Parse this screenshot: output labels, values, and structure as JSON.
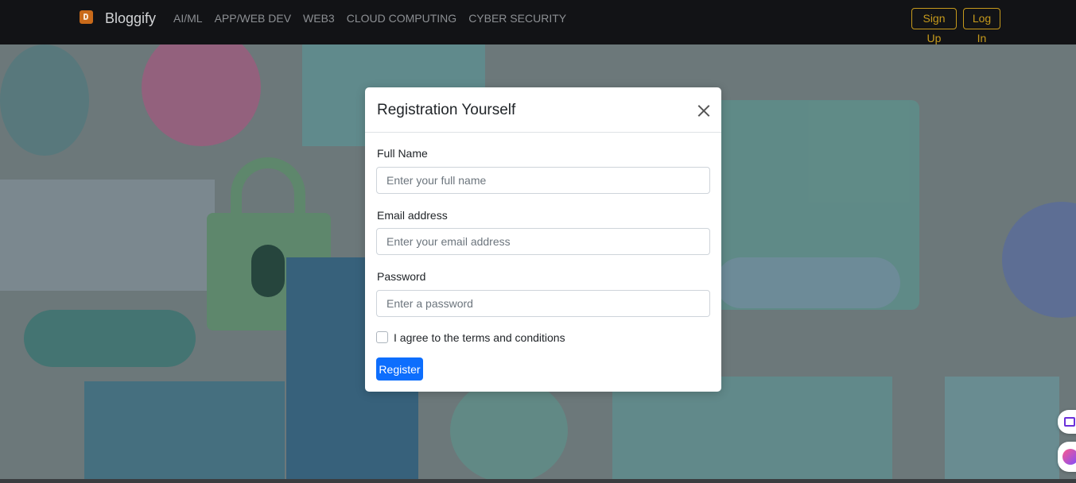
{
  "navbar": {
    "brand": "Bloggify",
    "links": [
      "AI/ML",
      "APP/WEB DEV",
      "WEB3",
      "CLOUD COMPUTING",
      "CYBER SECURITY"
    ],
    "signup_label": "Sign Up",
    "login_label": "Log In"
  },
  "modal": {
    "title": "Registration Yourself",
    "fields": [
      {
        "label": "Full Name",
        "placeholder": "Enter your full name",
        "value": ""
      },
      {
        "label": "Email address",
        "placeholder": "Enter your email address",
        "value": ""
      },
      {
        "label": "Password",
        "placeholder": "Enter a password",
        "value": ""
      }
    ],
    "agree_label": "I agree to the terms and conditions",
    "submit_label": "Register"
  },
  "colors": {
    "accent": "#0d6efd",
    "auth_outline": "#c69a1c",
    "navbar_bg": "#121316"
  }
}
